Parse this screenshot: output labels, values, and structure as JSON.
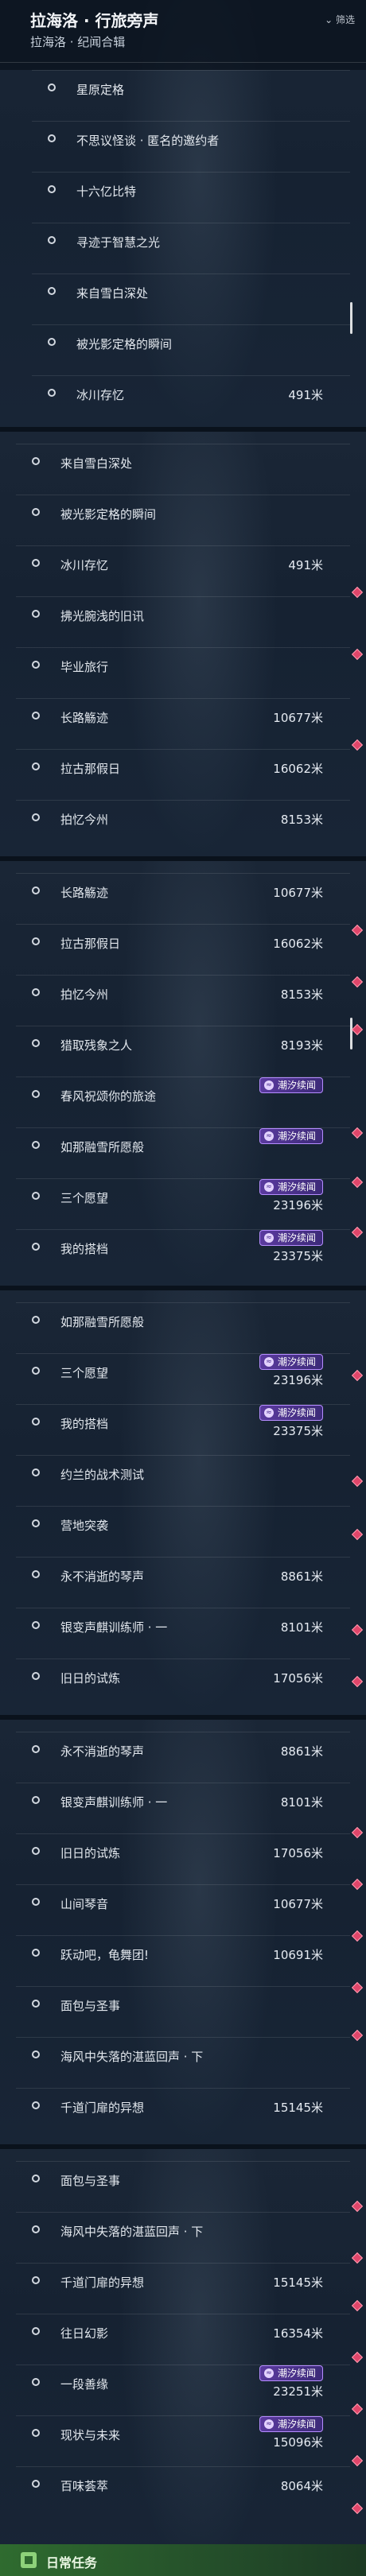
{
  "header": {
    "title": "拉海洛 · 行旅旁声",
    "subtitle": "拉海洛 · 纪闻合辑",
    "hint": "⌄ 筛选"
  },
  "icons": {
    "badge": "wave-icon",
    "bullet": "circle-icon",
    "marker": "diamond-icon",
    "footer": "book-icon"
  },
  "colors": {
    "badge_bg": "#5a3a9e",
    "marker": "#e0466a",
    "footer_bg": "#2f6b2f"
  },
  "shots": [
    {
      "rows": [
        {
          "label": "星原定格"
        },
        {
          "label": "不思议怪谈 · 匿名的邀约者"
        },
        {
          "label": "十六亿比特"
        },
        {
          "label": "寻迹于智慧之光"
        },
        {
          "label": "来自雪白深处"
        },
        {
          "label": "被光影定格的瞬间"
        },
        {
          "label": "冰川存忆",
          "dist": "491米"
        }
      ]
    },
    {
      "rows": [
        {
          "label": "来自雪白深处"
        },
        {
          "label": "被光影定格的瞬间"
        },
        {
          "label": "冰川存忆",
          "dist": "491米"
        },
        {
          "label": "拂光腕浅的旧讯"
        },
        {
          "label": "毕业旅行"
        },
        {
          "label": "长路觞迹",
          "dist": "10677米"
        },
        {
          "label": "拉古那假日",
          "dist": "16062米"
        },
        {
          "label": "拍忆今州",
          "dist": "8153米"
        }
      ]
    },
    {
      "rows": [
        {
          "label": "长路觞迹",
          "dist": "10677米"
        },
        {
          "label": "拉古那假日",
          "dist": "16062米"
        },
        {
          "label": "拍忆今州",
          "dist": "8153米"
        },
        {
          "label": "猎取残象之人",
          "dist": "8193米"
        },
        {
          "label": "春风祝颂你的旅途",
          "badge": "潮汐续闻"
        },
        {
          "label": "如那融雪所愿般",
          "badge": "潮汐续闻"
        },
        {
          "label": "三个愿望",
          "dist": "23196米",
          "badge": "潮汐续闻"
        },
        {
          "label": "我的搭档",
          "dist": "23375米",
          "badge": "潮汐续闻"
        }
      ]
    },
    {
      "rows": [
        {
          "label": "如那融雪所愿般"
        },
        {
          "label": "三个愿望",
          "dist": "23196米",
          "badge": "潮汐续闻"
        },
        {
          "label": "我的搭档",
          "dist": "23375米",
          "badge": "潮汐续闻"
        },
        {
          "label": "约兰的战术测试"
        },
        {
          "label": "营地突袭"
        },
        {
          "label": "永不消逝的琴声",
          "dist": "8861米"
        },
        {
          "label": "银变声麒训练师 · 一",
          "dist": "8101米"
        },
        {
          "label": "旧日的试炼",
          "dist": "17056米"
        }
      ]
    },
    {
      "rows": [
        {
          "label": "永不消逝的琴声",
          "dist": "8861米"
        },
        {
          "label": "银变声麒训练师 · 一",
          "dist": "8101米"
        },
        {
          "label": "旧日的试炼",
          "dist": "17056米"
        },
        {
          "label": "山间琴音",
          "dist": "10677米"
        },
        {
          "label": "跃动吧，龟舞团!",
          "dist": "10691米"
        },
        {
          "label": "面包与圣事"
        },
        {
          "label": "海风中失落的湛蓝回声 · 下"
        },
        {
          "label": "千道门扉的异想",
          "dist": "15145米"
        }
      ]
    },
    {
      "rows": [
        {
          "label": "面包与圣事"
        },
        {
          "label": "海风中失落的湛蓝回声 · 下"
        },
        {
          "label": "千道门扉的异想",
          "dist": "15145米"
        },
        {
          "label": "往日幻影",
          "dist": "16354米"
        },
        {
          "label": "一段善缘",
          "dist": "23251米",
          "badge": "潮汐续闻"
        },
        {
          "label": "现状与未来",
          "dist": "15096米",
          "badge": "潮汐续闻"
        },
        {
          "label": "百味荟萃",
          "dist": "8064米"
        }
      ]
    }
  ],
  "footer": {
    "label": "日常任务"
  }
}
